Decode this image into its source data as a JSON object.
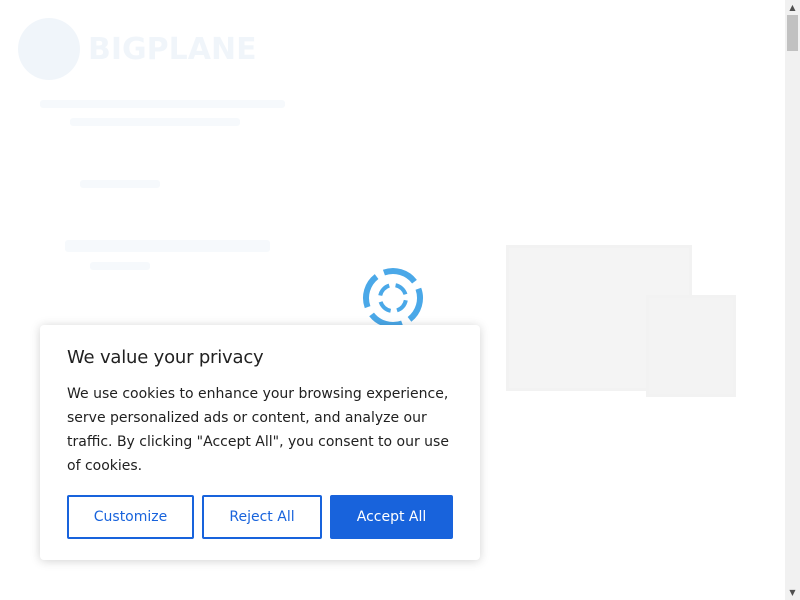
{
  "background": {
    "logo_text": "BIGPLANE"
  },
  "consent": {
    "title": "We value your privacy",
    "text": "We use cookies to enhance your browsing experience, serve personalized ads or content, and analyze our traffic. By clicking \"Accept All\", you consent to our use of cookies.",
    "buttons": {
      "customize": "Customize",
      "reject": "Reject All",
      "accept": "Accept All"
    }
  },
  "icons": {
    "spinner": "loading-spinner-icon",
    "scroll_up": "arrow-up-icon",
    "scroll_down": "arrow-down-icon"
  },
  "colors": {
    "accent": "#1863dc",
    "spinner": "#4aa8e8",
    "text": "#212121"
  }
}
